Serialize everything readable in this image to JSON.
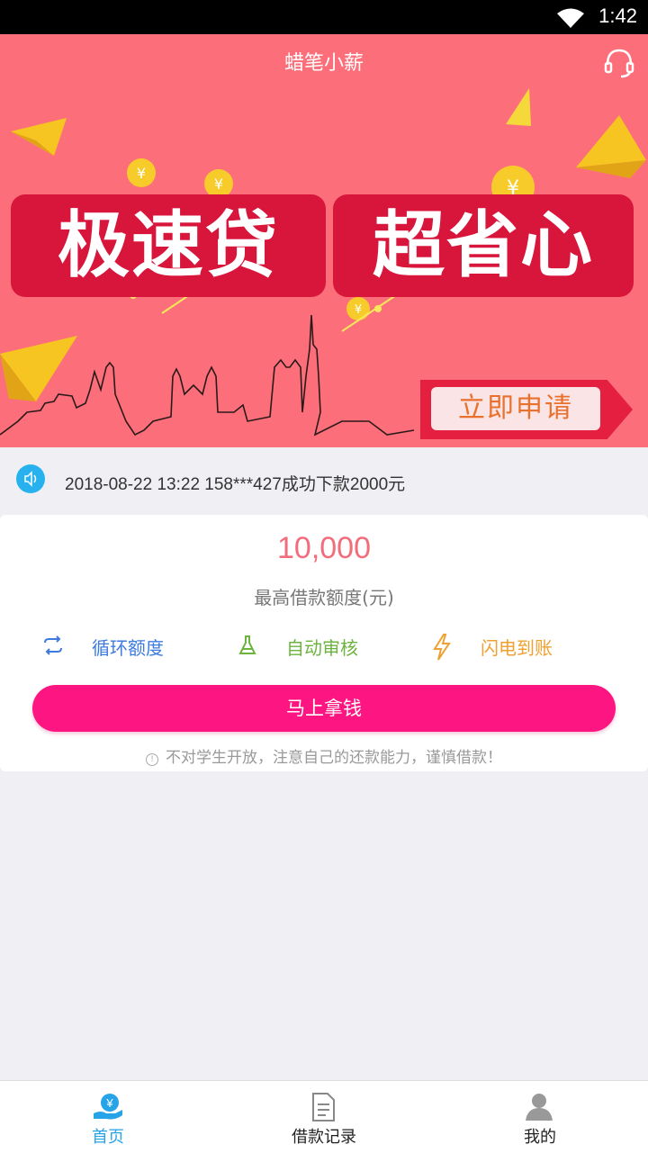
{
  "status_bar": {
    "time": "1:42"
  },
  "header": {
    "title": "蜡笔小薪"
  },
  "banner": {
    "slogan_left": "极速贷",
    "slogan_right": "超省心",
    "apply_label": "立即申请"
  },
  "notice": {
    "text": "2018-08-22 13:22 158***427成功下款2000元"
  },
  "loan_card": {
    "amount": "10,000",
    "amount_label": "最高借款额度(元)",
    "features": [
      {
        "label": "循环额度",
        "icon": "cycle-icon",
        "color": "#3d7be0"
      },
      {
        "label": "自动审核",
        "icon": "flask-icon",
        "color": "#6db33f"
      },
      {
        "label": "闪电到账",
        "icon": "lightning-icon",
        "color": "#f0a030"
      }
    ],
    "cta_label": "马上拿钱",
    "warning": "不对学生开放，注意自己的还款能力，谨慎借款！"
  },
  "tab_bar": {
    "items": [
      {
        "label": "首页",
        "icon": "home-money-icon",
        "active": true
      },
      {
        "label": "借款记录",
        "icon": "document-icon",
        "active": false
      },
      {
        "label": "我的",
        "icon": "user-icon",
        "active": false
      }
    ]
  },
  "colors": {
    "banner_bg": "#fc6f7a",
    "accent": "#fd1682",
    "active_tab": "#27a3e8"
  }
}
